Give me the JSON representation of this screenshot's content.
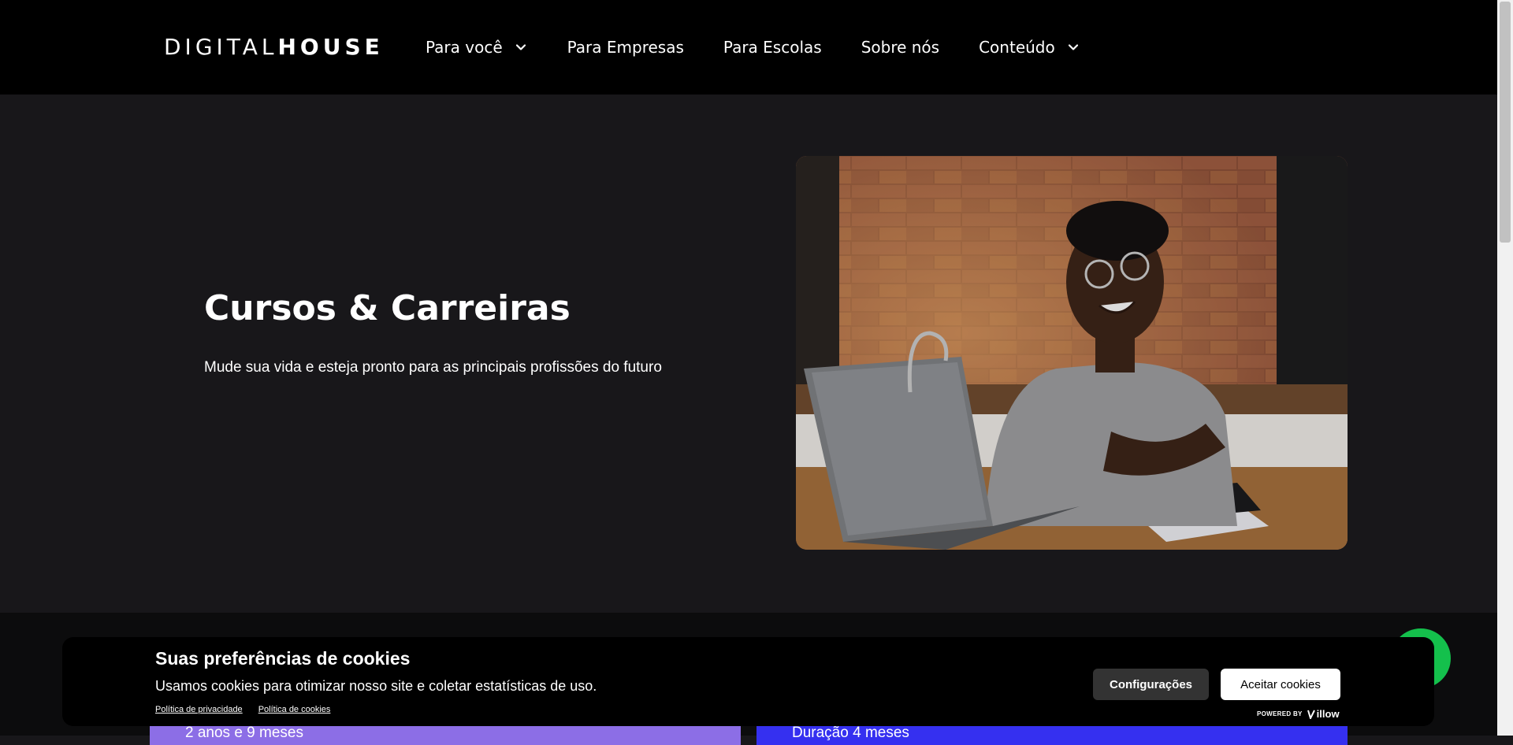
{
  "navbar": {
    "logo_light": "DIGITAL",
    "logo_bold": "HOUSE",
    "items": [
      {
        "label": "Para você",
        "has_dropdown": true
      },
      {
        "label": "Para Empresas",
        "has_dropdown": false
      },
      {
        "label": "Para Escolas",
        "has_dropdown": false
      },
      {
        "label": "Sobre nós",
        "has_dropdown": false
      },
      {
        "label": "Conteúdo",
        "has_dropdown": true
      }
    ]
  },
  "hero": {
    "title": "Cursos & Carreiras",
    "subtitle": "Mude sua vida e esteja pronto para as principais profissões do futuro"
  },
  "cards": {
    "left_text": "2 anos e 9 meses",
    "right_text": "Duração 4 meses"
  },
  "cookie": {
    "title": "Suas preferências de cookies",
    "text": "Usamos cookies para otimizar nosso site e coletar estatísticas de uso.",
    "privacy_link": "Política de privacidade",
    "cookies_link": "Política de cookies",
    "config_button": "Configurações",
    "accept_button": "Aceitar cookies",
    "powered_by": "POWERED BY",
    "brand": "illow"
  },
  "colors": {
    "nav_bg": "#000000",
    "hero_bg": "#18171a",
    "card_left": "#8c6ee6",
    "card_right": "#3530f0",
    "chat_green": "#14c04c"
  }
}
